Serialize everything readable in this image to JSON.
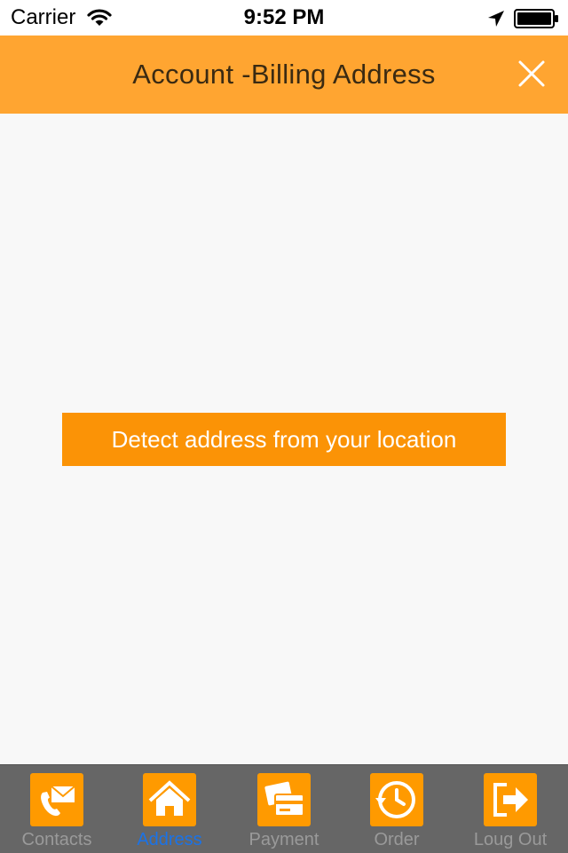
{
  "status_bar": {
    "carrier": "Carrier",
    "time": "9:52 PM",
    "icons": [
      "wifi-icon",
      "location-arrow-icon",
      "battery-icon"
    ]
  },
  "nav": {
    "title": "Account -Billing Address",
    "close_icon": "close-icon"
  },
  "main": {
    "detect_button_label": "Detect address from your location"
  },
  "tabs": [
    {
      "label": "Contacts",
      "icon": "contact-phone-mail-icon",
      "active": false
    },
    {
      "label": "Address",
      "icon": "home-icon",
      "active": true
    },
    {
      "label": "Payment",
      "icon": "credit-card-icon",
      "active": false
    },
    {
      "label": "Order",
      "icon": "order-history-icon",
      "active": false
    },
    {
      "label": "Loug Out",
      "icon": "logout-icon",
      "active": false
    }
  ],
  "colors": {
    "nav_background": "#ffa531",
    "button_background": "#fb9306",
    "tab_bar_background": "#666666",
    "tab_icon_background": "#ff9a00",
    "active_tab_label": "#1a73e8",
    "inactive_tab_label": "#9a9a9a"
  }
}
